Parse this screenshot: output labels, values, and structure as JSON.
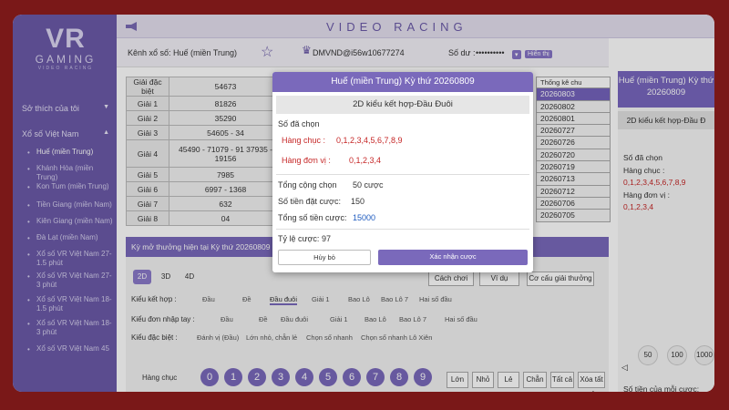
{
  "logo": {
    "main": "VR",
    "sub1": "GAMING",
    "sub2": "VIDEO RACING"
  },
  "topbar": {
    "title": "VIDEO RACING"
  },
  "sidebar": {
    "favorites": "Sở thích của tôi",
    "section": "Xổ số Việt Nam",
    "items": [
      "Huế (miền Trung)",
      "Khánh Hòa (miền Trung)",
      "Kon Tum (miền Trung)",
      "Tiền Giang (miền Nam)",
      "Kiên Giang (miền Nam)",
      "Đà Lạt (miền Nam)",
      "Xổ số VR Việt Nam 27-1.5 phút",
      "Xổ số VR Việt Nam 27-3 phút",
      "Xổ số VR Việt Nam 18-1.5 phút",
      "Xổ số VR Việt Nam 18-3 phút",
      "Xổ số VR Việt Nam 45"
    ]
  },
  "header": {
    "channel_label": "Kênh xổ số: Huế (miền Trung)",
    "user": "DMVND@i56w10677274",
    "balance_label": "Số dư :",
    "balance_value": "••••••••••",
    "show_label": "Hiển thị"
  },
  "results": [
    {
      "label": "Giải đặc biệt",
      "value": "54673"
    },
    {
      "label": "Giải 1",
      "value": "81826"
    },
    {
      "label": "Giải 2",
      "value": "35290"
    },
    {
      "label": "Giải 3",
      "value": "54605 - 34"
    },
    {
      "label": "Giải 4",
      "value": "45490 - 71079 - 91 37935 - 19156"
    },
    {
      "label": "Giải 5",
      "value": "7985"
    },
    {
      "label": "Giải 6",
      "value": "6997 - 1368"
    },
    {
      "label": "Giải 7",
      "value": "632"
    },
    {
      "label": "Giải 8",
      "value": "04"
    }
  ],
  "draws": {
    "header": "Thống kê chu",
    "list": [
      "20260803",
      "20260802",
      "20260801",
      "20260727",
      "20260726",
      "20260720",
      "20260719",
      "20260713",
      "20260712",
      "20260706",
      "20260705"
    ]
  },
  "banner": "Kỳ mở thưởng hiện tại Kỳ thứ 20260809",
  "lower": {
    "tabs": [
      "2D",
      "3D",
      "4D"
    ],
    "buttons": [
      "Cách chơi",
      "Ví dụ",
      "Cơ cấu giải thưởng"
    ],
    "row1_label": "Kiểu kết hợp :",
    "row1": [
      "Đầu",
      "Đề",
      "Đầu đuôi",
      "Giải 1",
      "Bao Lô",
      "Bao Lô 7",
      "Hai số đầu"
    ],
    "row2_label": "Kiểu đơn nhập tay :",
    "row2": [
      "Đầu",
      "Đề",
      "Đầu đuôi",
      "Giải 1",
      "Bao Lô",
      "Bao Lô 7",
      "Hai số đầu"
    ],
    "row3_label": "Kiểu đặc biệt :",
    "row3": [
      "Đánh vị (Đầu)",
      "Lớn nhỏ, chẵn lẻ",
      "Chọn số nhanh",
      "Chọn số nhanh Lô Xiên"
    ],
    "digits_label": "Hàng chục",
    "digits": [
      "0",
      "1",
      "2",
      "3",
      "4",
      "5",
      "6",
      "7",
      "8",
      "9"
    ],
    "controls": [
      "Lớn",
      "Nhỏ",
      "Lẻ",
      "Chẵn",
      "Tất cả",
      "Xóa tất cả"
    ]
  },
  "rpanel": {
    "title": "Huế (miền Trung) Kỳ thứ 20260809",
    "subtitle": "2D kiểu kết hợp-Đầu Đ",
    "selected": "Số đã chọn",
    "tens_label": "Hàng chục :",
    "tens": "0,1,2,3,4,5,6,7,8,9",
    "units_label": "Hàng đơn vị :",
    "units": "0,1,2,3,4",
    "amounts": [
      "50",
      "100",
      "1000"
    ],
    "per_bet": "Số tiền của mỗi cược:"
  },
  "modal": {
    "title": "Huế (miền Trung) Kỳ thứ 20260809",
    "subtitle": "2D kiểu kết hợp-Đầu Đuôi",
    "selected": "Số đã chọn",
    "tens_label": "Hàng chục :",
    "tens": "0,1,2,3,4,5,6,7,8,9",
    "units_label": "Hàng đơn vị :",
    "units": "0,1,2,3,4",
    "total_label": "Tổng cộng chọn",
    "total": "50 cược",
    "stake_label": "Số tiền đặt cược:",
    "stake": "150",
    "sum_label": "Tổng số tiền cược:",
    "sum": "15000",
    "rate_label": "Tỷ lệ cược:",
    "rate": "97",
    "cancel": "Hủy bỏ",
    "confirm": "Xác nhận cược"
  },
  "colors": {
    "accent": "#7a69bb",
    "frame": "#7a1818"
  }
}
